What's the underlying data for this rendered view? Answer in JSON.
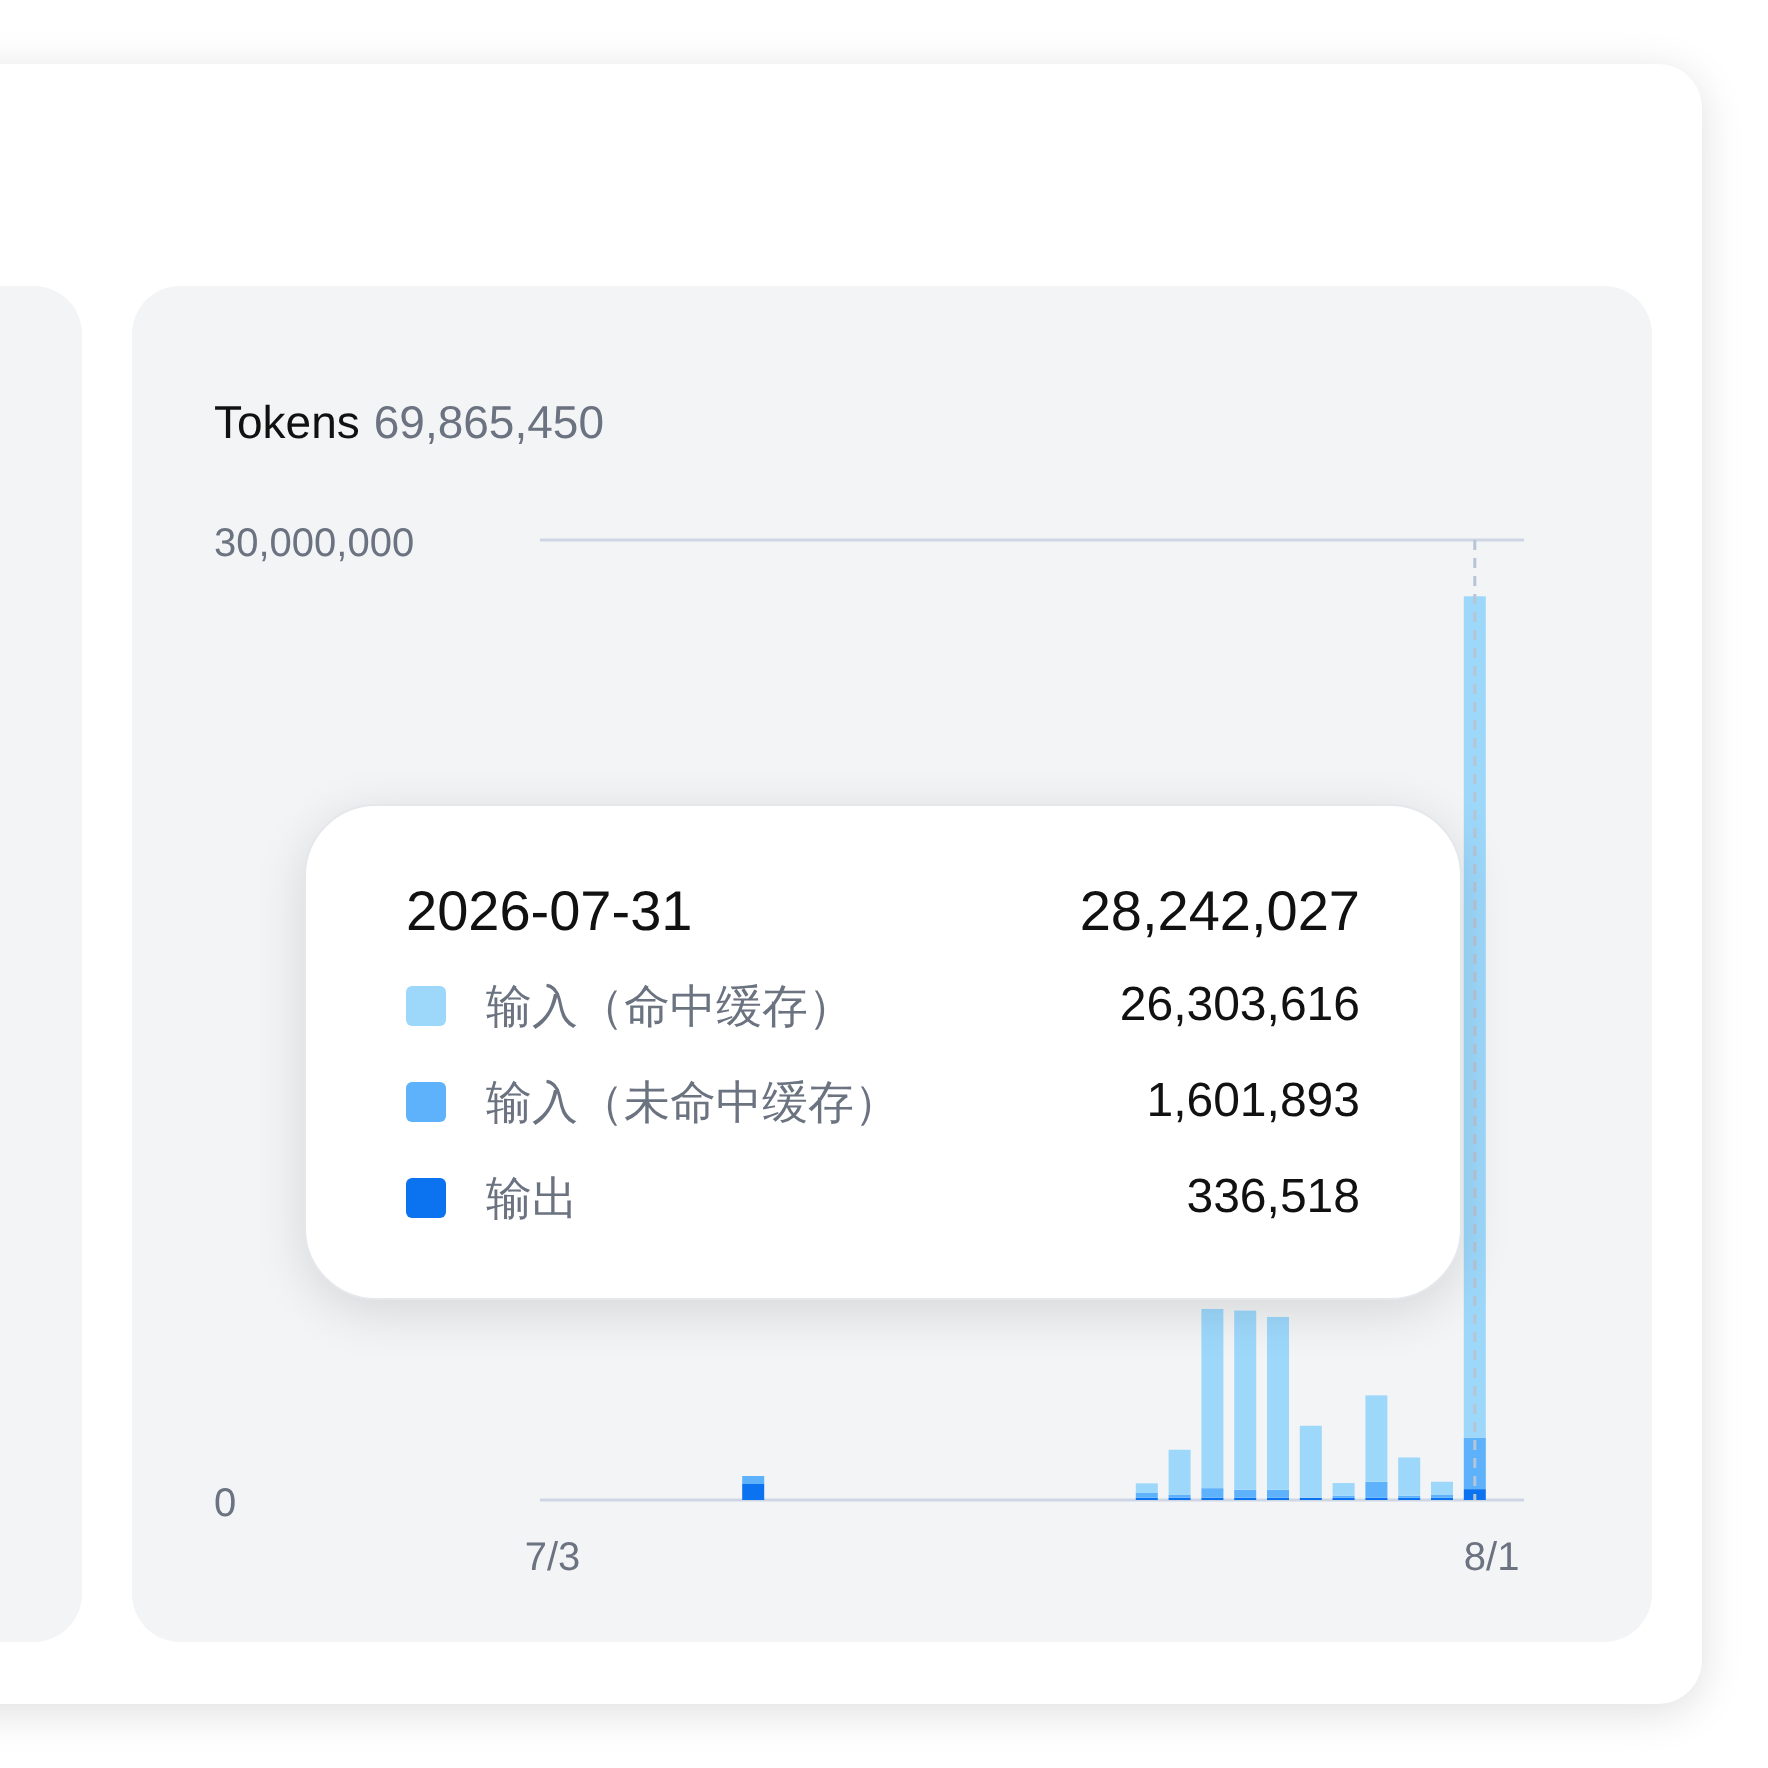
{
  "panel": {
    "title": "Tokens",
    "total": "69,865,450",
    "chart_data": {
      "type": "bar",
      "stacked": true,
      "categories": [
        "7/3",
        null,
        null,
        null,
        null,
        null,
        null,
        null,
        null,
        null,
        null,
        null,
        null,
        null,
        null,
        null,
        null,
        null,
        null,
        null,
        null,
        null,
        null,
        null,
        null,
        null,
        null,
        null,
        null,
        "8/1"
      ],
      "series": [
        {
          "name": "输出",
          "color": "#0b72f0",
          "values": [
            0,
            0,
            0,
            0,
            0,
            0,
            500000,
            0,
            0,
            0,
            0,
            0,
            0,
            0,
            0,
            0,
            0,
            0,
            70000,
            70000,
            70000,
            70000,
            70000,
            70000,
            70000,
            70000,
            70000,
            70000,
            340000,
            0
          ]
        },
        {
          "name": "输入（未命中缓存）",
          "color": "#5db2fb",
          "values": [
            0,
            0,
            0,
            0,
            0,
            0,
            250000,
            0,
            0,
            0,
            0,
            0,
            0,
            0,
            0,
            0,
            0,
            0,
            150000,
            100000,
            300000,
            250000,
            250000,
            0,
            60000,
            500000,
            60000,
            100000,
            1600000,
            0
          ]
        },
        {
          "name": "输入（命中缓存）",
          "color": "#9dd8fb",
          "values": [
            0,
            0,
            0,
            0,
            0,
            0,
            0,
            0,
            0,
            0,
            0,
            0,
            0,
            0,
            0,
            0,
            0,
            0,
            300000,
            1400000,
            5600000,
            5600000,
            5400000,
            2250000,
            400000,
            2700000,
            1200000,
            400000,
            26300000,
            0
          ]
        }
      ],
      "ylim": [
        0,
        30000000
      ],
      "yticks": [
        {
          "value": 0,
          "label": "0"
        },
        {
          "value": 30000000,
          "label": "30,000,000"
        }
      ]
    },
    "tooltip": {
      "date": "2026-07-31",
      "total": "28,242,027",
      "rows": [
        {
          "value": "26,303,616"
        },
        {
          "value": "1,601,893"
        },
        {
          "value": "336,518"
        }
      ]
    }
  }
}
